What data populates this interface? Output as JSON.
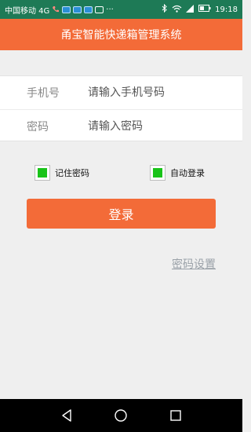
{
  "statusbar": {
    "carrier": "中国移动 4G",
    "ellipsis": "···",
    "time": "19:18"
  },
  "app": {
    "title": "甬宝智能快递箱管理系统"
  },
  "form": {
    "phone_label": "手机号",
    "phone_placeholder": "请输入手机号码",
    "password_label": "密码",
    "password_placeholder": "请输入密码"
  },
  "options": {
    "remember_label": "记住密码",
    "remember_checked": true,
    "auto_login_label": "自动登录",
    "auto_login_checked": true
  },
  "login_button": "登录",
  "password_settings_link": "密码设置",
  "colors": {
    "accent": "#f36b38",
    "status_bar": "#1e7a56",
    "checkbox": "#19c319"
  }
}
